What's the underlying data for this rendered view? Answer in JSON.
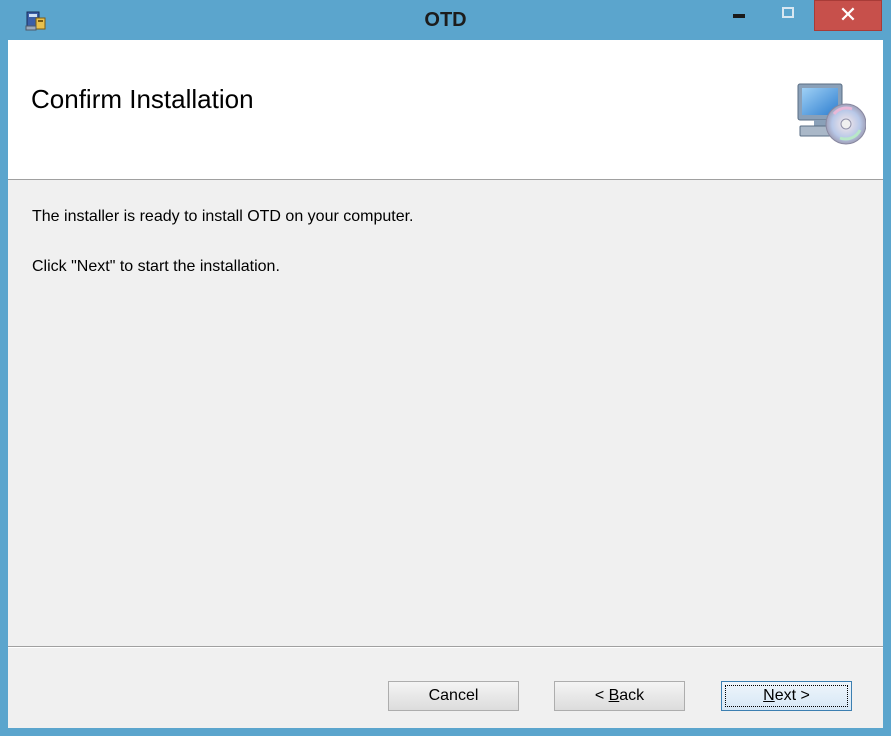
{
  "window": {
    "title": "OTD",
    "minimize_glyph": "",
    "close_glyph": "✕"
  },
  "header": {
    "title": "Confirm Installation",
    "icon": "computer-cd-icon"
  },
  "body": {
    "line1": "The installer is ready to install OTD on your computer.",
    "line2": "Click \"Next\" to start the installation."
  },
  "buttons": {
    "cancel": "Cancel",
    "back_arrow": "< ",
    "back_mnemonic": "B",
    "back_rest": "ack",
    "next_mnemonic": "N",
    "next_rest": "ext >"
  },
  "colors": {
    "titlebar": "#5ba5cd",
    "close": "#c7504b",
    "client": "#f0f0f0"
  }
}
